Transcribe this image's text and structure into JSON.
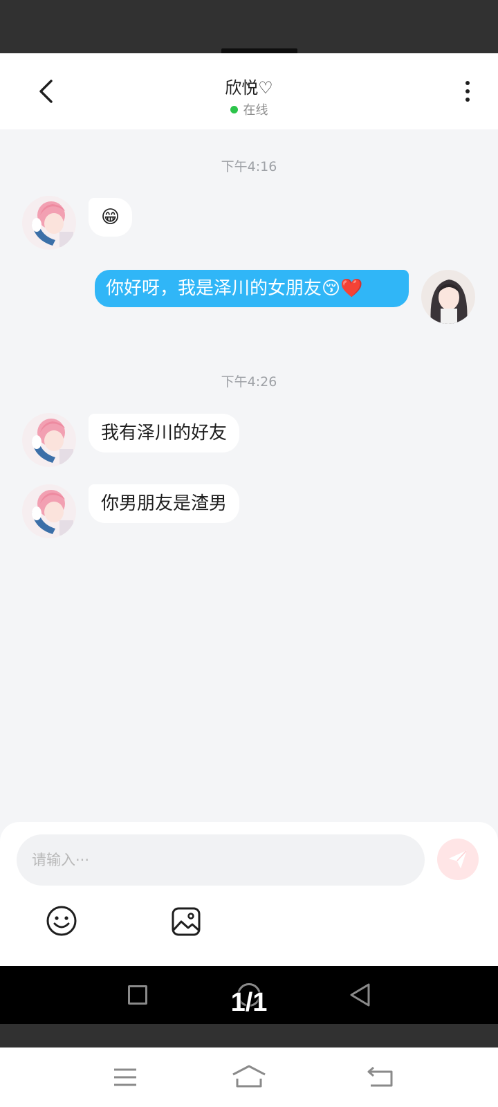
{
  "header": {
    "contact_name": "欣悦♡",
    "status": "在线",
    "status_color": "#2cc44a"
  },
  "messages": [
    {
      "type": "time",
      "text": "下午4:16"
    },
    {
      "type": "incoming",
      "text": "😁"
    },
    {
      "type": "outgoing",
      "text": "你好呀，我是泽川的女朋友😚❤️"
    },
    {
      "type": "time",
      "text": "下午4:26"
    },
    {
      "type": "incoming",
      "text": "我有泽川的好友"
    },
    {
      "type": "incoming",
      "text": "你男朋友是渣男"
    }
  ],
  "composer": {
    "placeholder": "请输入···",
    "accent_color": "#ff6b73"
  },
  "viewer": {
    "page_indicator": "1/1"
  },
  "colors": {
    "outgoing_bubble": "#30b6f7",
    "chat_background": "#f4f5f7"
  },
  "icons": {
    "back": "chevron-left-icon",
    "more": "more-vertical-icon",
    "send": "paper-plane-icon",
    "emoji": "smiley-icon",
    "image": "image-icon",
    "recents": "square-icon",
    "home": "circle-icon",
    "system_back": "triangle-back-icon",
    "menu": "hamburger-icon",
    "browser_home": "home-icon",
    "browser_back": "return-icon"
  }
}
